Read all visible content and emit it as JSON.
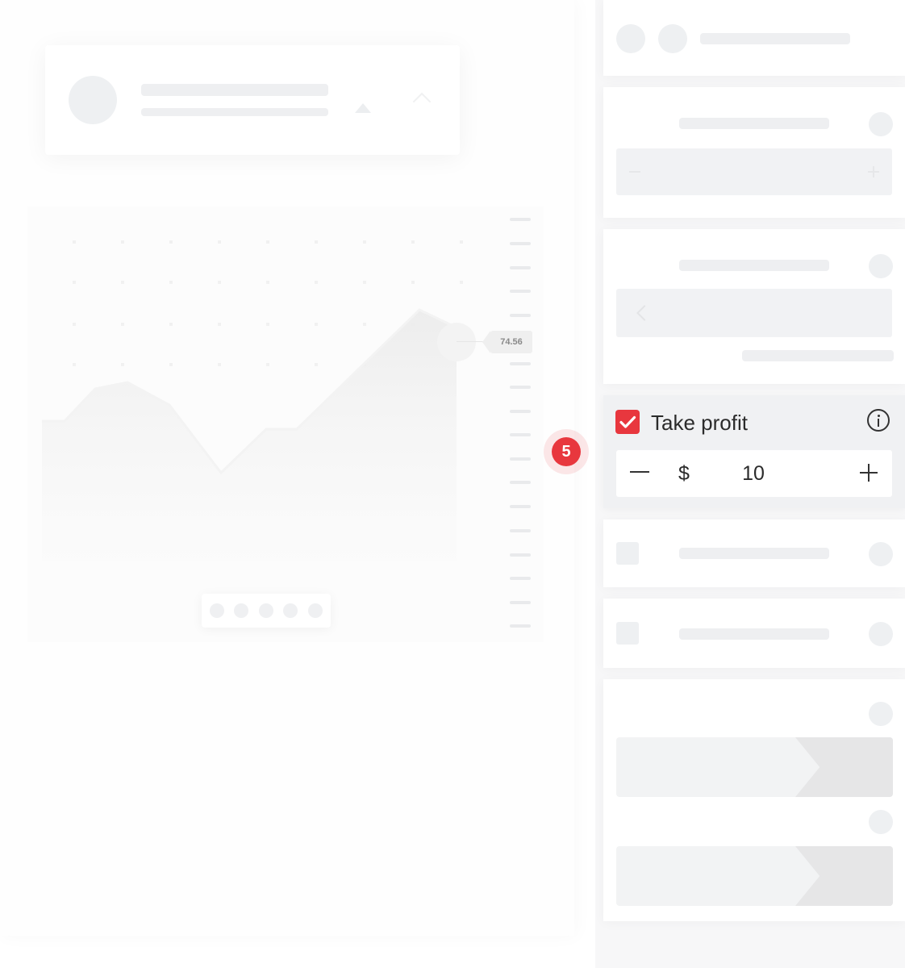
{
  "chart": {
    "price_label": "74.56"
  },
  "take_profit": {
    "checked": true,
    "label": "Take profit",
    "currency_symbol": "$",
    "value": "10",
    "step_number": "5"
  },
  "colors": {
    "accent": "#e8373e",
    "placeholder": "#eeeff1",
    "card_bg": "#f0f1f3"
  },
  "icons": {
    "checkbox": "check-icon",
    "info": "info-icon",
    "decrement": "minus-icon",
    "increment": "plus-icon",
    "back": "chevron-left-icon"
  }
}
